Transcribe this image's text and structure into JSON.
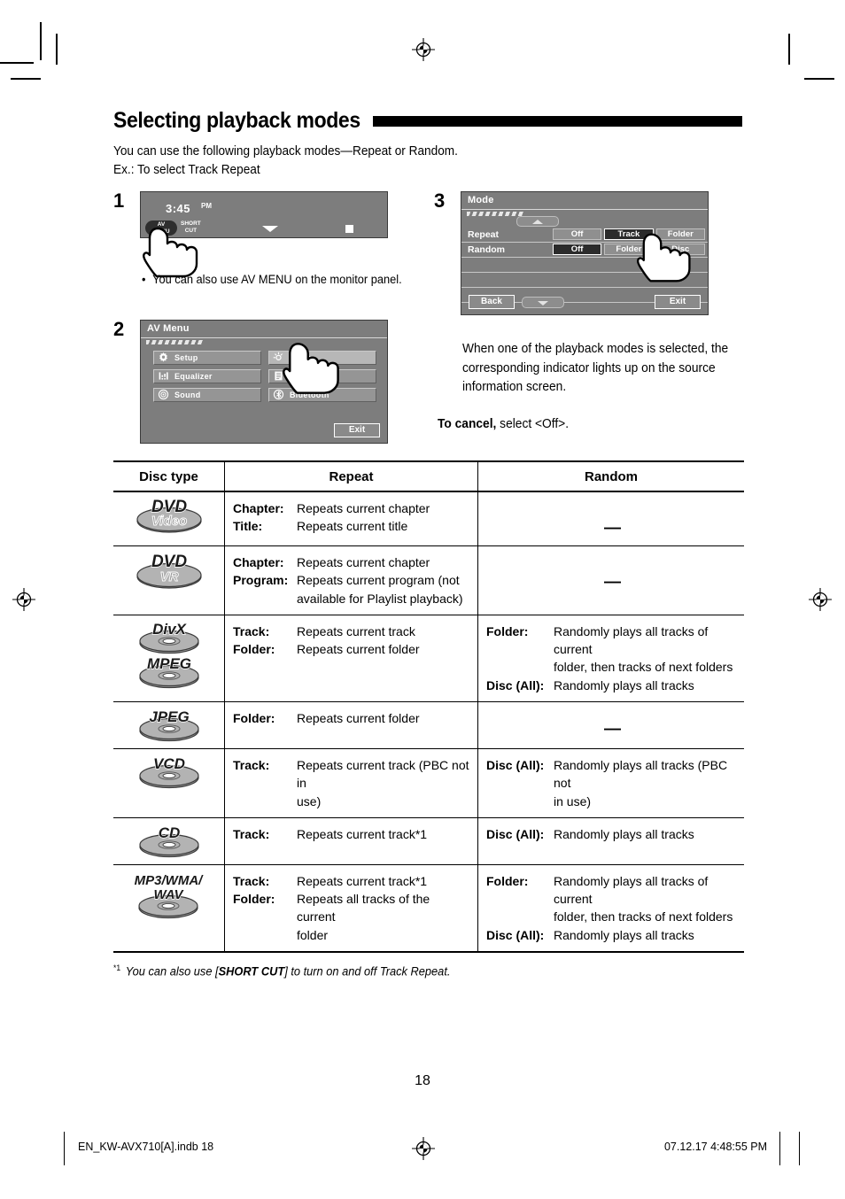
{
  "heading": {
    "title": "Selecting playback modes"
  },
  "intro": {
    "line1": "You can use the following playback modes—Repeat or Random.",
    "line2": "Ex.: To select Track Repeat"
  },
  "steps": {
    "one": {
      "number": "1",
      "screen": {
        "clock": "3:45",
        "ampm": "PM",
        "av_menu_line1": "AV",
        "av_menu_line2": "MENU",
        "shortcut_line1": "SHORT",
        "shortcut_line2": "CUT"
      },
      "note": "You can also use AV MENU on the monitor panel.",
      "note_bullet": "•"
    },
    "two": {
      "number": "2",
      "screen": {
        "title": "AV Menu",
        "items": [
          {
            "label": "Setup",
            "icon": "gear-icon",
            "highlight": false
          },
          {
            "label": "Mode",
            "icon": "brightness-icon",
            "highlight": true
          },
          {
            "label": "Equalizer",
            "icon": "equalizer-icon",
            "highlight": false
          },
          {
            "label": "List",
            "icon": "list-icon",
            "highlight": false
          },
          {
            "label": "Sound",
            "icon": "speaker-icon",
            "highlight": false
          },
          {
            "label": "Bluetooth",
            "icon": "bluetooth-icon",
            "highlight": false
          }
        ],
        "exit_label": "Exit"
      }
    },
    "three": {
      "number": "3",
      "screen": {
        "title": "Mode",
        "rows": [
          {
            "label": "Repeat",
            "options": [
              {
                "label": "Off",
                "selected": false
              },
              {
                "label": "Track",
                "selected": true
              },
              {
                "label": "Folder",
                "selected": false
              }
            ]
          },
          {
            "label": "Random",
            "options": [
              {
                "label": "Off",
                "selected": true
              },
              {
                "label": "Folder",
                "selected": false
              },
              {
                "label": "Disc",
                "selected": false
              }
            ]
          }
        ],
        "back_label": "Back",
        "exit_label": "Exit"
      },
      "paragraph": "When one of the playback modes is selected, the corresponding indicator lights up on the source information screen.",
      "cancel_bold": "To cancel,",
      "cancel_rest": " select <Off>."
    }
  },
  "table": {
    "headers": [
      "Disc type",
      "Repeat",
      "Random"
    ],
    "dash": "—",
    "rows": [
      {
        "disc": {
          "labels": [
            "DVD"
          ],
          "sublabel": "Video",
          "type": "dvd"
        },
        "repeat": [
          {
            "term": "Chapter:",
            "desc": "Repeats current chapter"
          },
          {
            "term": "Title:",
            "desc": "Repeats current title"
          }
        ],
        "random": []
      },
      {
        "disc": {
          "labels": [
            "DVD"
          ],
          "sublabel": "VR",
          "type": "dvd"
        },
        "repeat": [
          {
            "term": "Chapter:",
            "desc": "Repeats current chapter"
          },
          {
            "term": "Program:",
            "desc": "Repeats current program (not"
          },
          {
            "term": "",
            "desc": "available for Playlist playback)"
          }
        ],
        "random": []
      },
      {
        "disc": {
          "labels": [
            "DivX",
            "MPEG"
          ],
          "type": "disc"
        },
        "repeat": [
          {
            "term": "Track:",
            "desc": "Repeats current track"
          },
          {
            "term": "Folder:",
            "desc": "Repeats current folder"
          }
        ],
        "random": [
          {
            "term": "Folder:",
            "desc": "Randomly plays all tracks of current"
          },
          {
            "term": "",
            "desc": "folder, then tracks of next folders"
          },
          {
            "term": "Disc (All):",
            "desc": "Randomly plays all tracks"
          }
        ]
      },
      {
        "disc": {
          "labels": [
            "JPEG"
          ],
          "type": "disc"
        },
        "repeat": [
          {
            "term": "Folder:",
            "desc": "Repeats current folder"
          }
        ],
        "random": []
      },
      {
        "disc": {
          "labels": [
            "VCD"
          ],
          "type": "disc"
        },
        "repeat": [
          {
            "term": "Track:",
            "desc": "Repeats current track (PBC not in"
          },
          {
            "term": "",
            "desc": "use)"
          }
        ],
        "random": [
          {
            "term": "Disc (All):",
            "desc": "Randomly plays all tracks (PBC not"
          },
          {
            "term": "",
            "desc": "in use)"
          }
        ]
      },
      {
        "disc": {
          "labels": [
            "CD"
          ],
          "type": "disc"
        },
        "repeat": [
          {
            "term": "Track:",
            "desc": "Repeats current track*1",
            "footmark": "*1"
          }
        ],
        "random": [
          {
            "term": "Disc (All):",
            "desc": "Randomly plays all tracks"
          }
        ]
      },
      {
        "disc": {
          "labels": [
            "MP3/WMA/",
            "WAV"
          ],
          "type": "disc"
        },
        "repeat": [
          {
            "term": "Track:",
            "desc": "Repeats current track*1",
            "footmark": "*1"
          },
          {
            "term": "Folder:",
            "desc": "Repeats all tracks of the current"
          },
          {
            "term": "",
            "desc": "folder"
          }
        ],
        "random": [
          {
            "term": "Folder:",
            "desc": "Randomly plays all tracks of current"
          },
          {
            "term": "",
            "desc": "folder, then tracks of next folders"
          },
          {
            "term": "Disc (All):",
            "desc": "Randomly plays all tracks"
          }
        ]
      }
    ]
  },
  "footnote": {
    "mark": "*1",
    "text_before": "You can also use  [",
    "bold": "SHORT CUT",
    "text_after": "] to turn on and off Track Repeat."
  },
  "page_number": "18",
  "footer": {
    "left": "EN_KW-AVX710[A].indb   18",
    "right": "07.12.17   4:48:55 PM"
  }
}
